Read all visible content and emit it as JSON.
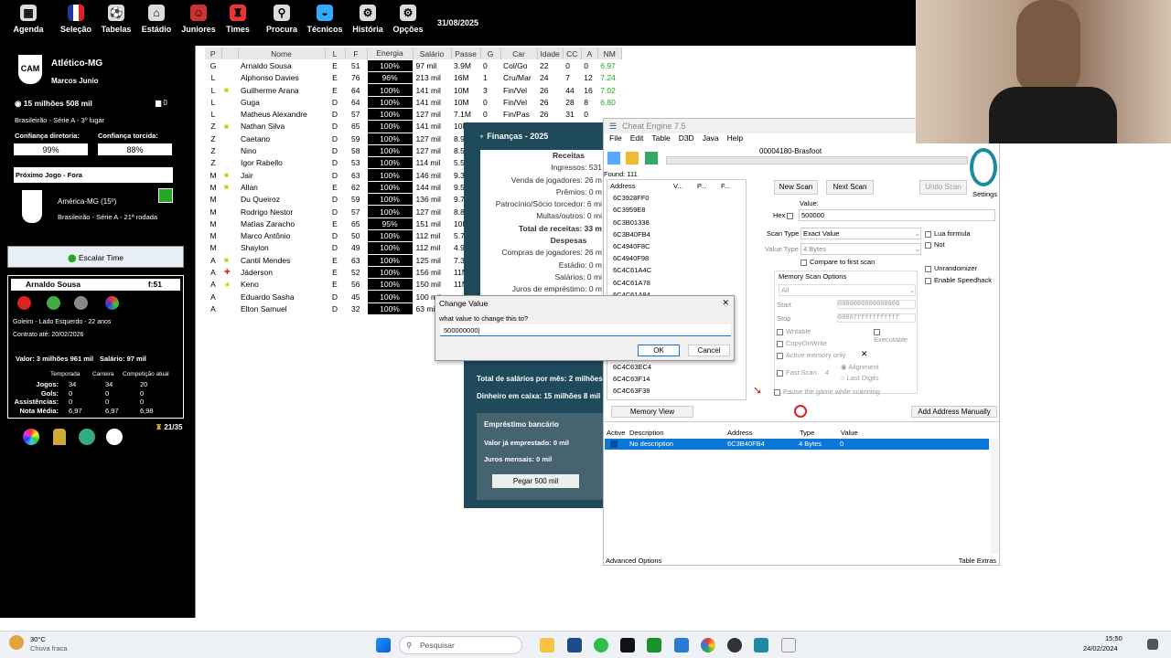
{
  "topbar": {
    "buttons": [
      "Agenda",
      "Seleção",
      "Tabelas",
      "Estádio",
      "Juniores",
      "Times",
      "Procura",
      "Técnicos",
      "História",
      "Opções"
    ],
    "date": "31/08/2025"
  },
  "club": {
    "name": "Atlético-MG",
    "manager": "Marcos Junio",
    "money": "15 milhões 508 mil",
    "messages": "0",
    "league": "Brasileirão - Série A - 3º lugar",
    "board_conf_label": "Confiança diretoria:",
    "fans_conf_label": "Confiança torcida:",
    "board_conf": "99%",
    "fans_conf": "88%",
    "board_conf_value": 0.99,
    "fans_conf_value": 0.88,
    "next_game_label": "Próximo Jogo - Fora",
    "next_opponent": "América-MG (15º)",
    "next_comp": "Brasileirão - Série A - 21ª rodada",
    "lineup_button": "Escalar Time"
  },
  "player_card": {
    "name": "Arnaldo Sousa",
    "force": "f:51",
    "desc": "Goleiro - Lado Esquerdo - 22 anos",
    "contract": "Contrato até: 20/02/2026",
    "value": "Valor: 3 milhões 961 mil",
    "salary": "Salário: 97 mil",
    "col_headers": [
      "Temporada",
      "Carreira",
      "Competição atual"
    ],
    "rows": [
      {
        "label": "Jogos:",
        "v": [
          "34",
          "34",
          "20"
        ]
      },
      {
        "label": "Gols:",
        "v": [
          "0",
          "0",
          "0"
        ]
      },
      {
        "label": "Assistências:",
        "v": [
          "0",
          "0",
          "0"
        ]
      },
      {
        "label": "Nota Média:",
        "v": [
          "6,97",
          "6,97",
          "6,98"
        ]
      }
    ],
    "rank": "21/35"
  },
  "table": {
    "headers": [
      "P",
      "",
      "Nome",
      "L",
      "F",
      "Energia",
      "Salário",
      "Passe",
      "G",
      "Car",
      "Idade",
      "CC",
      "A",
      "NM"
    ],
    "rows": [
      [
        "G",
        "",
        "Arnaldo Sousa",
        "E",
        "51",
        "100%",
        "97 mil",
        "3.9M",
        "0",
        "Col/Go",
        "22",
        "0",
        "0",
        "6.97"
      ],
      [
        "L",
        "",
        "Alphonso Davies",
        "E",
        "76",
        "96%",
        "213 mil",
        "16M",
        "1",
        "Cru/Mar",
        "24",
        "7",
        "12",
        "7.24"
      ],
      [
        "L",
        "■",
        "Guilherme Arana",
        "E",
        "64",
        "100%",
        "141 mil",
        "10M",
        "3",
        "Fin/Vel",
        "26",
        "44",
        "16",
        "7.02"
      ],
      [
        "L",
        "",
        "Guga",
        "D",
        "64",
        "100%",
        "141 mil",
        "10M",
        "0",
        "Fin/Vel",
        "26",
        "28",
        "8",
        "6.80"
      ],
      [
        "L",
        "",
        "Matheus Alexandre",
        "D",
        "57",
        "100%",
        "127 mil",
        "7.1M",
        "0",
        "Fin/Pas",
        "26",
        "31",
        "0",
        ""
      ],
      [
        "Z",
        "■",
        "Nathan Silva",
        "D",
        "65",
        "100%",
        "141 mil",
        "10M",
        "",
        "",
        "",
        "",
        "",
        ""
      ],
      [
        "Z",
        "",
        "Caetano",
        "D",
        "59",
        "100%",
        "127 mil",
        "8.9M",
        "",
        "",
        "",
        "",
        "",
        ""
      ],
      [
        "Z",
        "",
        "Nino",
        "D",
        "58",
        "100%",
        "127 mil",
        "8.5M",
        "",
        "",
        "",
        "",
        "",
        ""
      ],
      [
        "Z",
        "",
        "Igor Rabello",
        "D",
        "53",
        "100%",
        "114 mil",
        "5.5M",
        "",
        "",
        "",
        "",
        "",
        ""
      ],
      [
        "M",
        "■",
        "Jair",
        "D",
        "63",
        "100%",
        "146 mil",
        "9.3M",
        "",
        "",
        "",
        "",
        "",
        ""
      ],
      [
        "M",
        "■",
        "Allan",
        "E",
        "62",
        "100%",
        "144 mil",
        "9.5M",
        "",
        "",
        "",
        "",
        "",
        ""
      ],
      [
        "M",
        "",
        "Du Queiroz",
        "D",
        "59",
        "100%",
        "136 mil",
        "9.7M",
        "",
        "",
        "",
        "",
        "",
        ""
      ],
      [
        "M",
        "",
        "Rodrigo Nestor",
        "D",
        "57",
        "100%",
        "127 mil",
        "8.8M",
        "",
        "",
        "",
        "",
        "",
        ""
      ],
      [
        "M",
        "",
        "Matías Zaracho",
        "E",
        "65",
        "95%",
        "151 mil",
        "10M",
        "",
        "",
        "",
        "",
        "",
        ""
      ],
      [
        "M",
        "",
        "Marco Antônio",
        "D",
        "50",
        "100%",
        "112 mil",
        "5.7M",
        "",
        "",
        "",
        "",
        "",
        ""
      ],
      [
        "M",
        "",
        "Shaylon",
        "D",
        "49",
        "100%",
        "112 mil",
        "4.9M",
        "",
        "",
        "",
        "",
        "",
        ""
      ],
      [
        "A",
        "■",
        "Cantil Mendes",
        "E",
        "63",
        "100%",
        "125 mil",
        "7.3M",
        "",
        "",
        "",
        "",
        "",
        ""
      ],
      [
        "A",
        "✚",
        "Jáderson",
        "E",
        "52",
        "100%",
        "156 mil",
        "11M",
        "",
        "",
        "",
        "",
        "",
        ""
      ],
      [
        "A",
        "★",
        "Keno",
        "E",
        "56",
        "100%",
        "150 mil",
        "11M",
        "",
        "",
        "",
        "",
        "",
        ""
      ],
      [
        "A",
        "",
        "Eduardo Sasha",
        "D",
        "45",
        "100%",
        "100 mil",
        "",
        "",
        "",
        "",
        "",
        "",
        ""
      ],
      [
        "A",
        "",
        "Elton Samuel",
        "D",
        "32",
        "100%",
        "63 mil",
        "",
        "",
        "",
        "",
        "",
        "",
        ""
      ]
    ]
  },
  "finance": {
    "title": "Finanças - 2025",
    "lines": [
      "Receitas",
      "Ingressos: 531",
      "Venda de jogadores: 26 m",
      "Prêmios: 0 m",
      "Patrocínio/Sócio torcedor: 6 mi",
      "Multas/outros: 0 mi",
      "Total de receitas: 33 m",
      "Despesas",
      "Compras de jogadores: 26 m",
      "Estádio: 0 m",
      "Salários: 0 mi",
      "Juros de empréstimo: 0 m"
    ],
    "salaries_month": "Total de salários por mês: 2 milhões",
    "cash": "Dinheiro em caixa: 15 milhões 8 mil",
    "loan_title": "Empréstimo bancário",
    "loan_taken": "Valor já emprestado: 0 mil",
    "loan_interest": "Juros mensais: 0 mil",
    "loan_button": "Pegar 500 mil"
  },
  "ce": {
    "title": "Cheat Engine 7.5",
    "menu": [
      "File",
      "Edit",
      "Table",
      "D3D",
      "Java",
      "Help"
    ],
    "process": "00004180-Brasfoot",
    "found": "Found: 111",
    "list_headers": [
      "Address",
      "V...",
      "P...",
      "F..."
    ],
    "addresses": [
      "6C3928FF0",
      "6C3959E8",
      "6C3B01338",
      "6C3B40FB4",
      "6C4940F8C",
      "6C4940F98",
      "6C4C61A4C",
      "6C4C61A78",
      "6C4C61A84",
      "",
      "",
      "",
      "",
      "6C4C63E84",
      "6C4C63EC4",
      "6C4C63F14",
      "6C4C63F38"
    ],
    "new_scan": "New Scan",
    "next_scan": "Next Scan",
    "undo_scan": "Undo Scan",
    "settings": "Settings",
    "value_label": "Value:",
    "hex_label": "Hex",
    "value": "500000",
    "scan_type_label": "Scan Type",
    "scan_type": "Exact Value",
    "value_type_label": "Value Type",
    "value_type": "4 Bytes",
    "lua_formula": "Lua formula",
    "not_label": "Not",
    "compare_first": "Compare to first scan",
    "unrandomizer": "Unrandomizer",
    "speedhack": "Enable Speedhack",
    "mem_scan_options": "Memory Scan Options",
    "mem_region": "All",
    "start_label": "Start",
    "start": "0000000000000000",
    "stop_label": "Stop",
    "stop": "00007fffffffffff",
    "writable": "Writable",
    "executable": "Executable",
    "copyonwrite": "CopyOnWrite",
    "active_mem": "Active memory only",
    "fast_scan": "Fast Scan",
    "fast_scan_val": "4",
    "alignment": "Alignment",
    "last_digits": "Last Digits",
    "pause_game": "Pause the game while scanning",
    "memory_view": "Memory View",
    "add_manual": "Add Address Manually",
    "table_headers": [
      "Active",
      "Description",
      "Address",
      "Type",
      "Value"
    ],
    "entry": {
      "description": "No description",
      "address": "6C3B40FB4",
      "type": "4 Bytes",
      "value": "0"
    },
    "advanced": "Advanced Options",
    "table_extras": "Table Extras"
  },
  "dialog": {
    "title": "Change Value",
    "prompt": "what value to change this to?",
    "input": "500000000",
    "ok": "OK",
    "cancel": "Cancel"
  },
  "taskbar": {
    "weather_temp": "30°C",
    "weather_desc": "Chuva fraca",
    "search": "Pesquisar",
    "time": "15:50",
    "date": "24/02/2024"
  }
}
